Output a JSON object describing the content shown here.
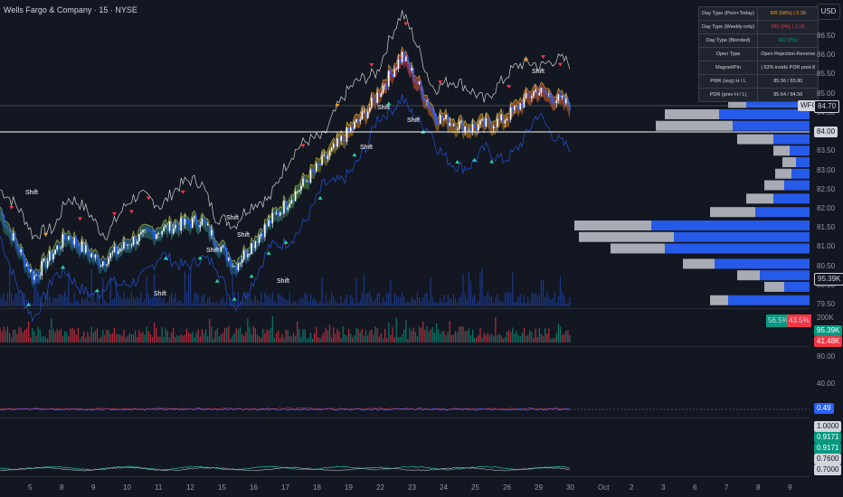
{
  "header": {
    "title": "Wells Fargo & Company · 15 · NYSE",
    "currency": "USD"
  },
  "price_axis": {
    "ticks": [
      "86.50",
      "86.00",
      "85.50",
      "85.00",
      "84.50",
      "84.00",
      "83.50",
      "83.00",
      "82.50",
      "82.00",
      "81.50",
      "81.00",
      "80.50",
      "80.00",
      "79.50"
    ]
  },
  "price_tags": {
    "symbol": "WFC",
    "last": "84.70",
    "hline": "84.00",
    "volume": "95.39K"
  },
  "volume_axis": {
    "top": "200K",
    "vol_tag": "95.39K",
    "vol_tag2": "41.48K",
    "buy_pct": "56.5%",
    "sell_pct": "43.5%"
  },
  "osc1_axis": {
    "top": "80.00",
    "mid": "40.00",
    "value": "0.49"
  },
  "osc2_axis": {
    "tags": [
      "1.0000",
      "0.9171",
      "0.9171",
      "0.7600",
      "0.7000"
    ]
  },
  "time_axis": {
    "labels": [
      "5",
      "8",
      "9",
      "10",
      "11",
      "12",
      "15",
      "16",
      "17",
      "18",
      "19",
      "22",
      "23",
      "24",
      "25",
      "26",
      "29",
      "30",
      "Oct",
      "2",
      "3",
      "6",
      "7",
      "8",
      "9"
    ]
  },
  "info_table": [
    {
      "key": "Day Type (Prior+Today)",
      "value": "RR (58%) | 0.39",
      "color": "#f7a21b"
    },
    {
      "key": "Day Type (Weekly-only)",
      "value": "RD (0%) | 3.15",
      "color": "#f23645"
    },
    {
      "key": "Day Type (Blended)",
      "value": "RD (0%)",
      "color": "#089981"
    },
    {
      "key": "Open Type",
      "value": "Open Rejection-Reverse",
      "color": "#d1d4dc"
    },
    {
      "key": "Magnet/Pin",
      "value": "| 53% inside PDR post-8",
      "color": "#d1d4dc"
    },
    {
      "key": "PWK (avg) H / L",
      "value": "85.56 / 83.80",
      "color": "#d1d4dc"
    },
    {
      "key": "PDR (prev H / L)",
      "value": "85.64 / 84.56",
      "color": "#d1d4dc"
    }
  ],
  "chart_labels": {
    "shift": "Shift"
  },
  "colors": {
    "up": "#089981",
    "down": "#f23645",
    "blue": "#2962ff",
    "profile_grey": "#c3c6ce"
  },
  "chart_data": {
    "type": "line",
    "title": "Wells Fargo & Company · 15 · NYSE",
    "ylim": [
      79.3,
      86.95
    ],
    "x": [
      "5",
      "8",
      "9",
      "10",
      "11",
      "12",
      "15",
      "16",
      "17",
      "18",
      "19",
      "22",
      "23",
      "24",
      "25",
      "26",
      "29",
      "30"
    ],
    "series": [
      {
        "values": [
          81.9,
          80.2,
          81.3,
          80.6,
          81.2,
          81.5,
          81.7,
          80.5,
          81.6,
          82.6,
          83.6,
          84.6,
          86.0,
          84.4,
          84.1,
          84.3,
          85.1,
          84.7
        ]
      }
    ]
  }
}
